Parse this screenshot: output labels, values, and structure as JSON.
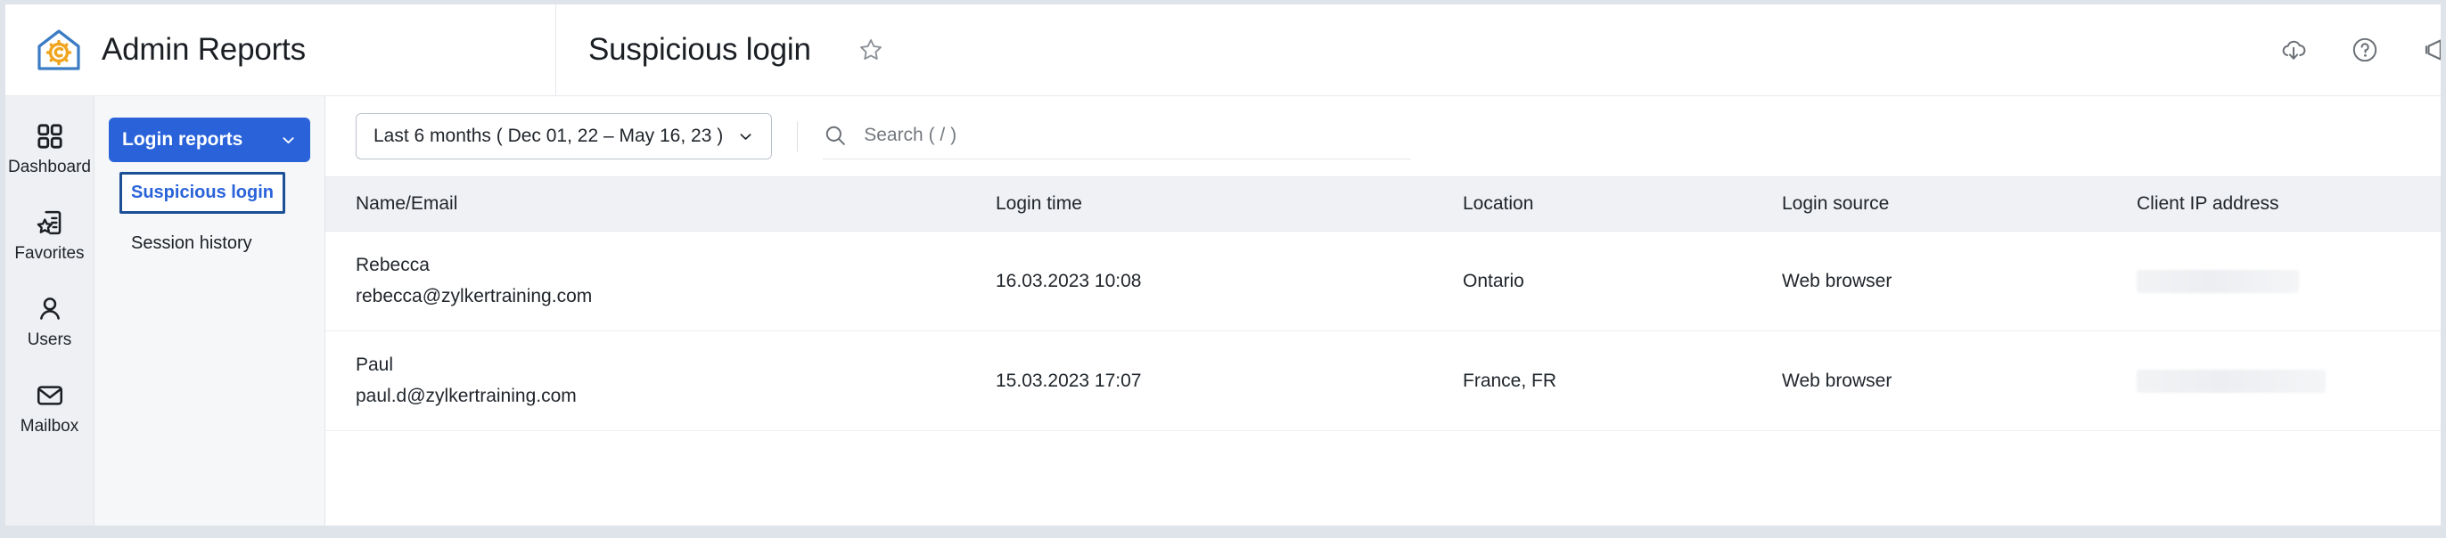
{
  "brand": {
    "title": "Admin Reports",
    "logo_icon": "home-gear-icon",
    "logo_outline_color": "#3b7cc4",
    "logo_gear_color": "#f0a51e"
  },
  "header": {
    "page_title": "Suspicious login",
    "favorite_icon": "star-outline-icon",
    "actions": [
      {
        "name": "cloud-download-icon",
        "label": "Download"
      },
      {
        "name": "help-icon",
        "label": "Help"
      },
      {
        "name": "megaphone-icon",
        "label": "Announcements"
      }
    ]
  },
  "rail": {
    "items": [
      {
        "label": "Dashboard",
        "icon": "grid-squares-icon",
        "active": false
      },
      {
        "label": "Favorites",
        "icon": "document-star-icon",
        "active": false
      },
      {
        "label": "Users",
        "icon": "person-icon",
        "active": false
      },
      {
        "label": "Mailbox",
        "icon": "envelope-icon",
        "active": false
      }
    ]
  },
  "subnav": {
    "group_label": "Login reports",
    "group_chevron_icon": "chevron-down-icon",
    "items": [
      {
        "label": "Suspicious login",
        "active": true
      },
      {
        "label": "Session history",
        "active": false
      }
    ]
  },
  "toolbar": {
    "date_range_label": "Last 6 months ( Dec 01, 22 – May 16, 23 )",
    "date_range_chevron_icon": "chevron-down-icon",
    "search_icon": "search-icon",
    "search_placeholder": "Search ( / )",
    "search_value": ""
  },
  "table": {
    "columns": [
      "Name/Email",
      "Login time",
      "Location",
      "Login source",
      "Client IP address"
    ],
    "rows": [
      {
        "name": "Rebecca",
        "email": "rebecca@zylkertraining.com",
        "login_time": "16.03.2023 10:08",
        "location": "Ontario",
        "login_source": "Web browser",
        "client_ip": ""
      },
      {
        "name": "Paul",
        "email": "paul.d@zylkertraining.com",
        "login_time": "15.03.2023 17:07",
        "location": "France, FR",
        "login_source": "Web browser",
        "client_ip": ""
      }
    ]
  },
  "colors": {
    "accent_blue": "#2a63d9",
    "active_border": "#1b4f96",
    "rail_bg": "#eef0f3",
    "subnav_bg": "#f5f7f9",
    "thead_bg": "#eff1f4",
    "text": "#21262c",
    "window_chrome": "#dfe4ea"
  }
}
